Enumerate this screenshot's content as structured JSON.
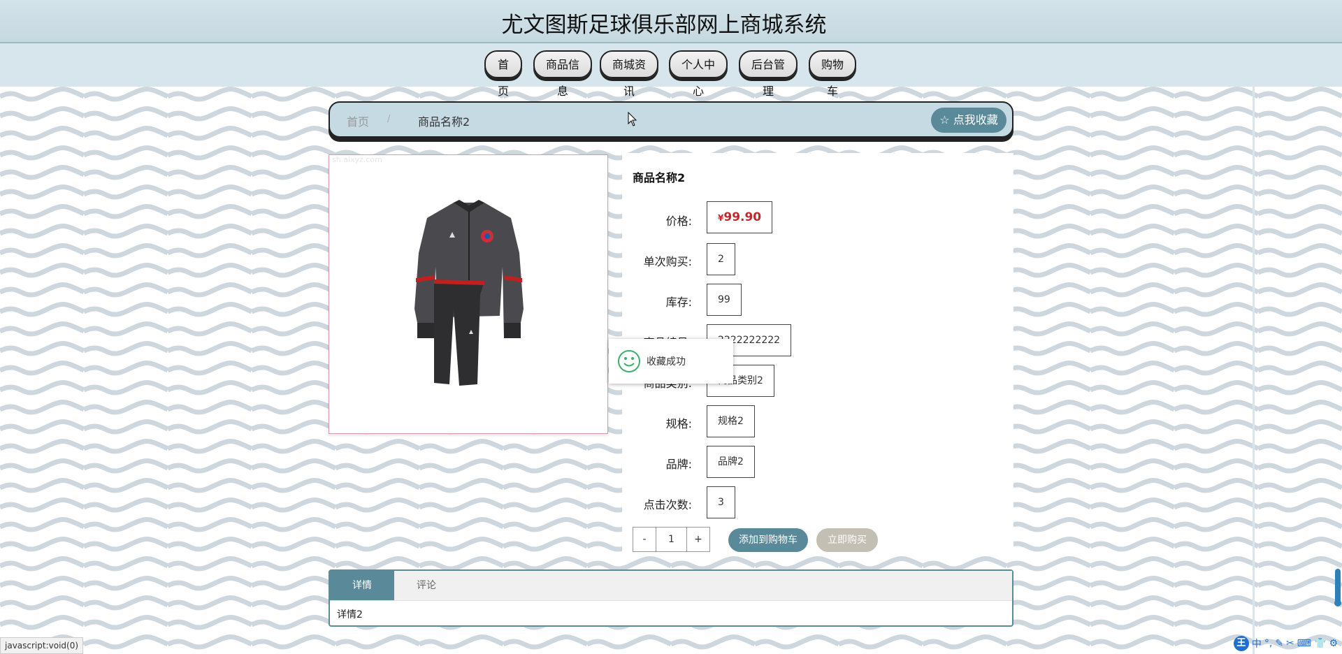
{
  "site": {
    "title": "尤文图斯足球俱乐部网上商城系统"
  },
  "nav": {
    "items": [
      {
        "label": "首页"
      },
      {
        "label": "商品信息"
      },
      {
        "label": "商城资讯"
      },
      {
        "label": "个人中心"
      },
      {
        "label": "后台管理"
      },
      {
        "label": "购物车"
      }
    ]
  },
  "breadcrumb": {
    "home": "首页",
    "separator": "/",
    "current": "商品名称2",
    "favorite_label": "☆ 点我收藏"
  },
  "product": {
    "image_watermark": "sh.alxyz.com",
    "name": "商品名称2",
    "price_symbol": "¥",
    "price": "99.90",
    "rows": [
      {
        "label": "价格:"
      },
      {
        "label": "单次购买:",
        "value": "2"
      },
      {
        "label": "库存:",
        "value": "99"
      },
      {
        "label": "商品编号:",
        "value": "2222222222"
      },
      {
        "label": "商品类别:",
        "value": "商品类别2"
      },
      {
        "label": "规格:",
        "value": "规格2"
      },
      {
        "label": "品牌:",
        "value": "品牌2"
      },
      {
        "label": "点击次数:",
        "value": "3"
      }
    ],
    "quantity": {
      "minus": "-",
      "value": "1",
      "plus": "+"
    },
    "add_to_cart_label": "添加到购物车",
    "buy_now_label": "立即购买"
  },
  "toast": {
    "message": "收藏成功",
    "icon": "smile-icon"
  },
  "tabs": {
    "items": [
      {
        "label": "详情"
      },
      {
        "label": "评论"
      }
    ],
    "active_content": "详情2"
  },
  "status_bar": {
    "text": "javascript:void(0)"
  },
  "tray": {
    "ime_label": "王",
    "items": [
      "中",
      "°,",
      "✎",
      "✂",
      "⌨",
      "👕",
      "⚙"
    ]
  },
  "colors": {
    "accent": "#5a8a99",
    "price": "#c0292b",
    "header_bg": "#c9dbe3",
    "buy_now_bg": "#c4bfb3"
  }
}
